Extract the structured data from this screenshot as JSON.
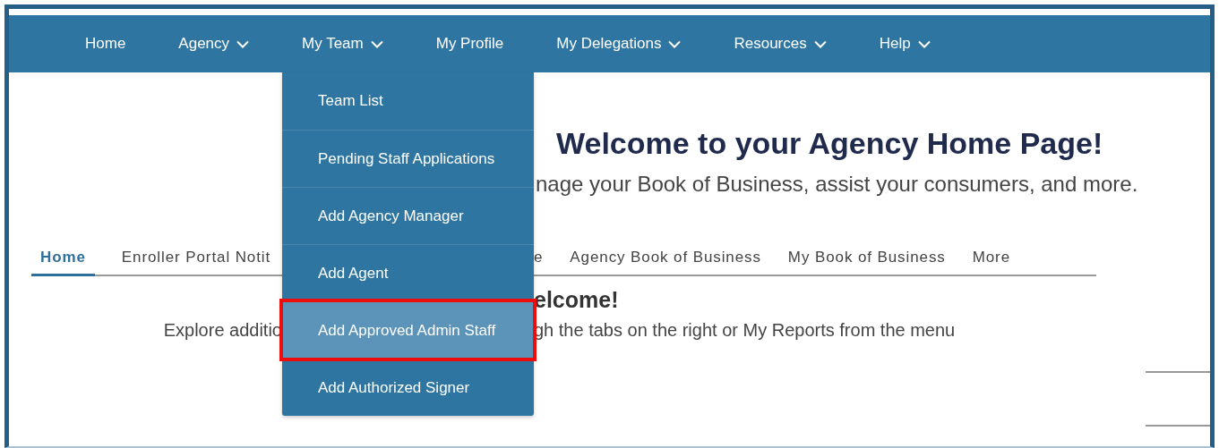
{
  "nav": [
    {
      "label": "Home",
      "has_menu": false
    },
    {
      "label": "Agency",
      "has_menu": true
    },
    {
      "label": "My Team",
      "has_menu": true,
      "expanded": true,
      "menu": [
        {
          "label": "Team List",
          "selected": false
        },
        {
          "label": "Pending Staff Applications",
          "selected": false
        },
        {
          "label": "Add Agency Manager",
          "selected": false
        },
        {
          "label": "Add Agent",
          "selected": false
        },
        {
          "label": "Add Approved Admin Staff",
          "selected": true
        },
        {
          "label": "Add Authorized Signer",
          "selected": false
        }
      ]
    },
    {
      "label": "My Profile",
      "has_menu": false
    },
    {
      "label": "My Delegations",
      "has_menu": true
    },
    {
      "label": "Resources",
      "has_menu": true
    },
    {
      "label": "Help",
      "has_menu": true
    }
  ],
  "heading": "Welcome to your Agency Home Page!",
  "subtitle": "nage your Book of Business, assist your consumers, and more.",
  "tabs_left": [
    {
      "label": "Home",
      "selected": true
    },
    {
      "label": "Enroller Portal Notit",
      "selected": false
    }
  ],
  "tabs_right": [
    {
      "label": "e",
      "selected": false
    },
    {
      "label": "Agency Book of Business",
      "selected": false
    },
    {
      "label": "My Book of Business",
      "selected": false
    },
    {
      "label": "More",
      "selected": false
    }
  ],
  "welcome": "elcome!",
  "explore_left": "Explore additio",
  "explore_right": "gh the tabs on the right or My Reports from the menu"
}
